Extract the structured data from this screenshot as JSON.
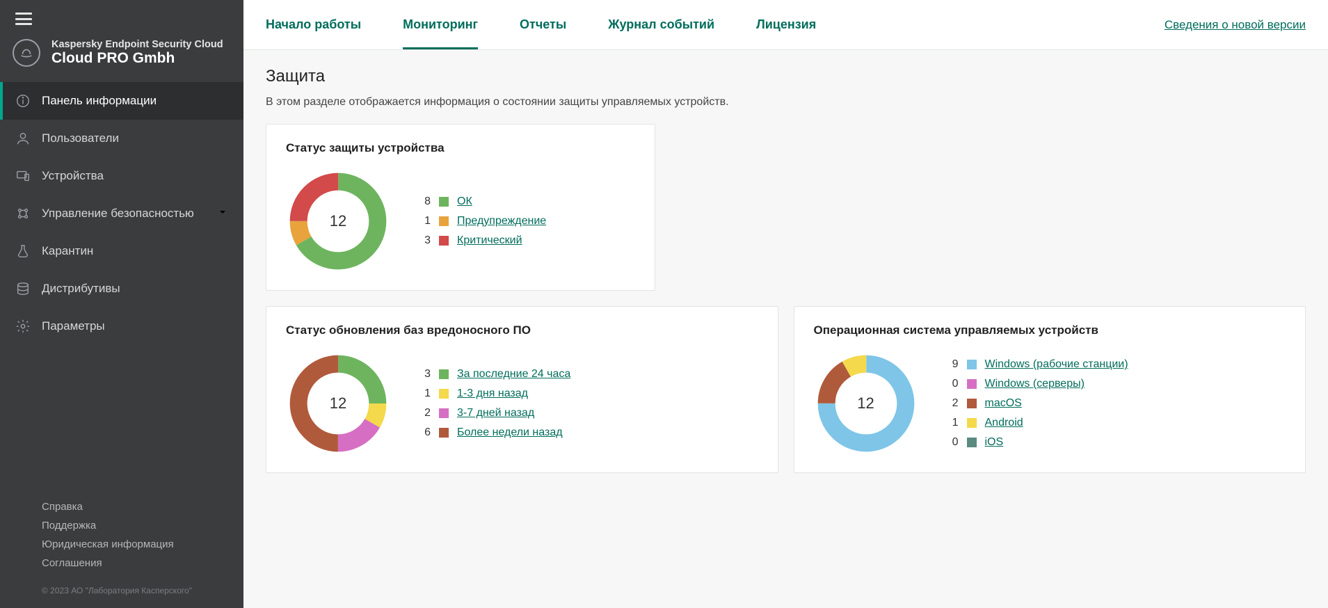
{
  "brand": {
    "line1": "Kaspersky Endpoint Security Cloud",
    "line2": "Cloud PRO Gmbh"
  },
  "sidebar": {
    "items": [
      {
        "label": "Панель информации"
      },
      {
        "label": "Пользователи"
      },
      {
        "label": "Устройства"
      },
      {
        "label": "Управление безопасностью"
      },
      {
        "label": "Карантин"
      },
      {
        "label": "Дистрибутивы"
      },
      {
        "label": "Параметры"
      }
    ],
    "footer": {
      "help": "Справка",
      "support": "Поддержка",
      "legal": "Юридическая информация",
      "agreements": "Соглашения",
      "copyright": "© 2023 АО \"Лаборатория Касперского\""
    }
  },
  "tabs": {
    "items": [
      "Начало работы",
      "Мониторинг",
      "Отчеты",
      "Журнал событий",
      "Лицензия"
    ],
    "version_link": "Сведения о новой версии"
  },
  "page": {
    "title": "Защита",
    "desc": "В этом разделе отображается информация о состоянии защиты управляемых устройств."
  },
  "cards": {
    "protection": {
      "title": "Статус защиты устройства",
      "total": 12,
      "items": [
        {
          "count": 8,
          "label": "ОК",
          "color": "#6eb45f"
        },
        {
          "count": 1,
          "label": "Предупреждение",
          "color": "#e8a33d"
        },
        {
          "count": 3,
          "label": "Критический",
          "color": "#d24a4a"
        }
      ]
    },
    "updates": {
      "title": "Статус обновления баз вредоносного ПО",
      "total": 12,
      "items": [
        {
          "count": 3,
          "label": "За последние 24 часа",
          "color": "#6eb45f"
        },
        {
          "count": 1,
          "label": "1-3 дня назад",
          "color": "#f3d94b"
        },
        {
          "count": 2,
          "label": "3-7 дней назад",
          "color": "#d66fc3"
        },
        {
          "count": 6,
          "label": "Более недели назад",
          "color": "#b05a3c"
        }
      ]
    },
    "os": {
      "title": "Операционная система управляемых устройств",
      "total": 12,
      "items": [
        {
          "count": 9,
          "label": "Windows (рабочие станции)",
          "color": "#7ec5e8"
        },
        {
          "count": 0,
          "label": "Windows (серверы)",
          "color": "#d66fc3"
        },
        {
          "count": 2,
          "label": "macOS",
          "color": "#b05a3c"
        },
        {
          "count": 1,
          "label": "Android",
          "color": "#f3d94b"
        },
        {
          "count": 0,
          "label": "iOS",
          "color": "#5a8a80"
        }
      ]
    }
  },
  "chart_data": [
    {
      "type": "pie",
      "title": "Статус защиты устройства",
      "categories": [
        "ОК",
        "Предупреждение",
        "Критический"
      ],
      "values": [
        8,
        1,
        3
      ],
      "total": 12,
      "colors": [
        "#6eb45f",
        "#e8a33d",
        "#d24a4a"
      ]
    },
    {
      "type": "pie",
      "title": "Статус обновления баз вредоносного ПО",
      "categories": [
        "За последние 24 часа",
        "1-3 дня назад",
        "3-7 дней назад",
        "Более недели назад"
      ],
      "values": [
        3,
        1,
        2,
        6
      ],
      "total": 12,
      "colors": [
        "#6eb45f",
        "#f3d94b",
        "#d66fc3",
        "#b05a3c"
      ]
    },
    {
      "type": "pie",
      "title": "Операционная система управляемых устройств",
      "categories": [
        "Windows (рабочие станции)",
        "Windows (серверы)",
        "macOS",
        "Android",
        "iOS"
      ],
      "values": [
        9,
        0,
        2,
        1,
        0
      ],
      "total": 12,
      "colors": [
        "#7ec5e8",
        "#d66fc3",
        "#b05a3c",
        "#f3d94b",
        "#5a8a80"
      ]
    }
  ]
}
